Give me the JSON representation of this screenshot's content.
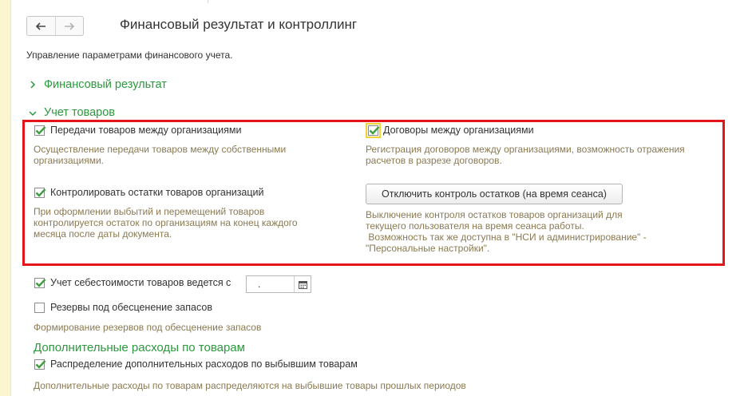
{
  "header": {
    "back_icon": "arrow-left-icon",
    "forward_icon": "arrow-right-icon",
    "title": "Финансовый результат и контроллинг",
    "subtitle": "Управление параметрами финансового учета."
  },
  "sections": {
    "fin_result": {
      "label": "Финансовый результат",
      "expanded": false,
      "icon": "chevron-right-icon"
    },
    "goods": {
      "label": "Учет товаров",
      "expanded": true,
      "icon": "chevron-down-icon"
    }
  },
  "options": {
    "transfers": {
      "label": "Передачи товаров между организациями",
      "checked": true,
      "hint": "Осуществление передачи товаров между собственными организациями."
    },
    "contracts": {
      "label": "Договоры между организациями",
      "checked": true,
      "hint": "Регистрация договоров между организациями, возможность отражения расчетов  в разрезе договоров."
    },
    "control_stock": {
      "label": "Контролировать остатки товаров организаций",
      "checked": true,
      "hint": "При оформлении выбытий и перемещений товаров контролируется остаток по организациям на конец каждого месяца после даты документа."
    },
    "disable_control": {
      "button_label": "Отключить контроль остатков (на время сеанса)",
      "hint_line1": "Выключение контроля остатков товаров организаций для",
      "hint_line2": "текущего пользователя на время сеанса работы.",
      "hint_line3": " Возможность так же доступна в \"НСИ и администрирование\" -",
      "hint_line4": "\"Персональные настройки\"."
    },
    "cost_accounting": {
      "label": "Учет себестоимости товаров ведется с",
      "checked": true,
      "date_value": ".",
      "calendar_icon": "calendar-icon"
    },
    "reserves": {
      "label": "Резервы под обесценение запасов",
      "checked": false,
      "hint": "Формирование резервов под обесценение запасов"
    }
  },
  "additional_costs": {
    "title": "Дополнительные расходы по товарам",
    "distribution": {
      "label": "Распределение дополнительных расходов по выбывшим товарам",
      "checked": true,
      "hint": "Дополнительные расходы по товарам распределяются на выбывшие товары прошлых периодов"
    }
  },
  "colors": {
    "section_green": "#2a9a3c",
    "highlight_red": "#e4141b",
    "hint_brown": "#8a7a52",
    "check_green": "#3f9e3f"
  }
}
